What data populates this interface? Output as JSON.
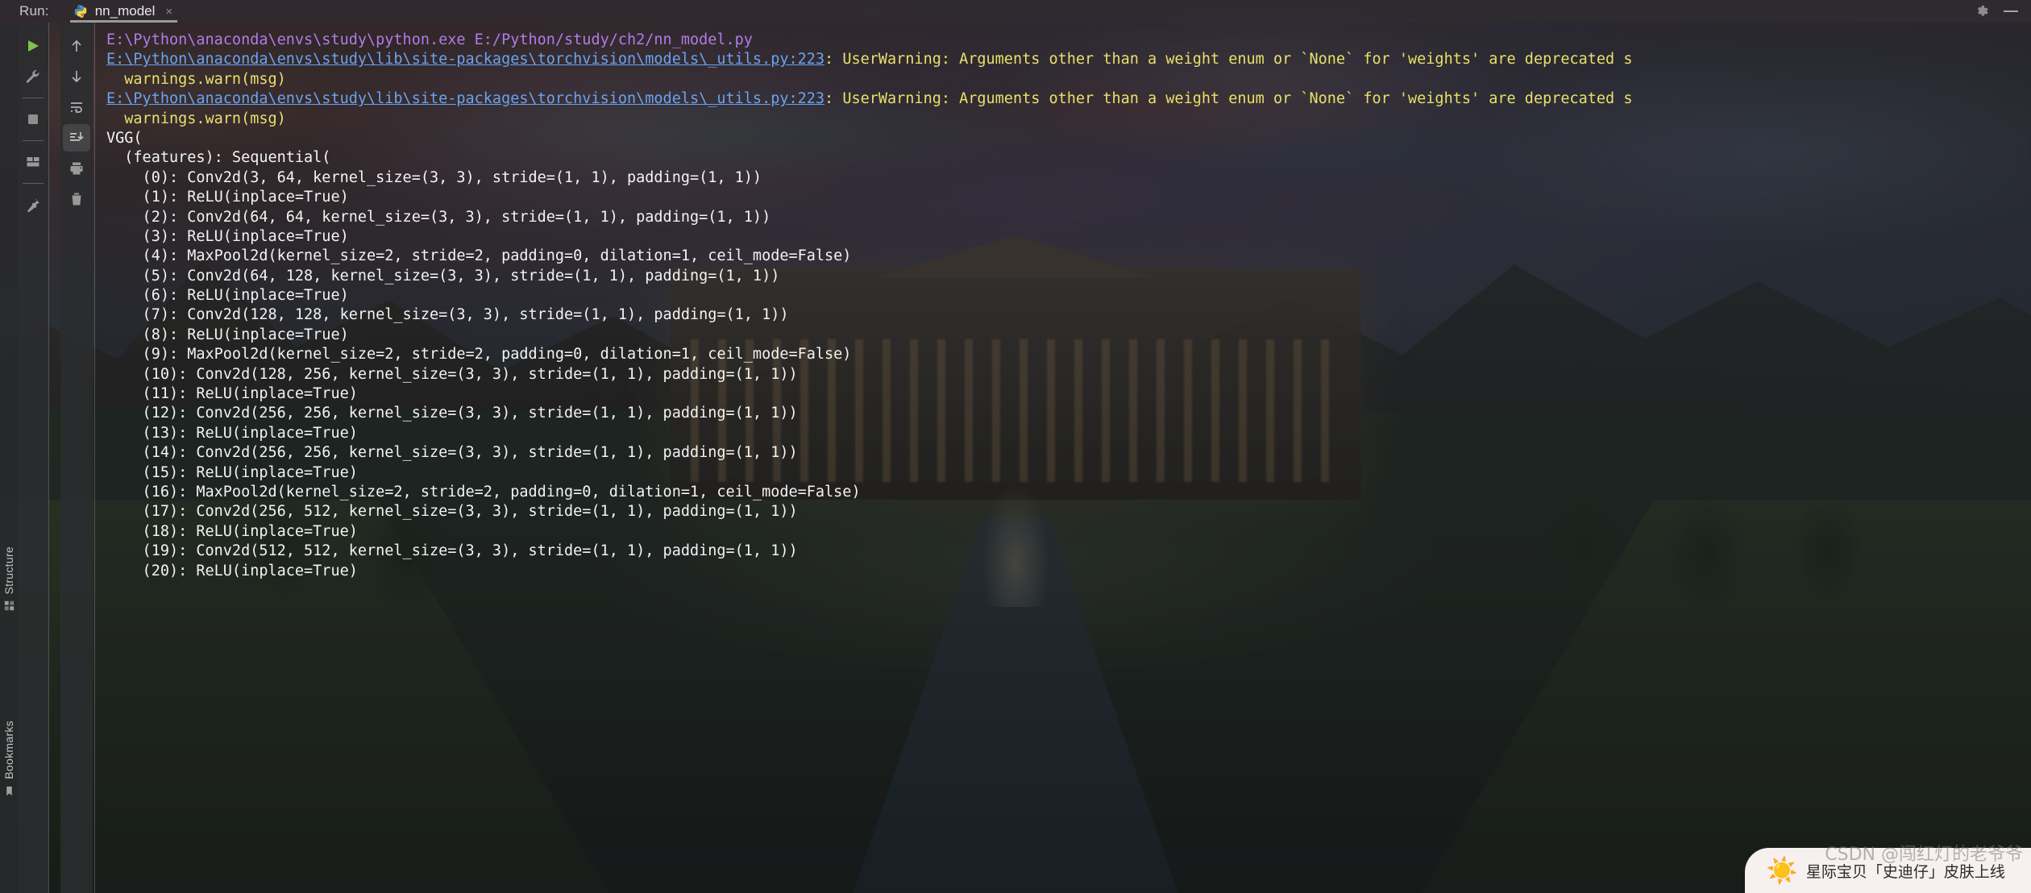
{
  "header": {
    "run_label": "Run:",
    "tab": {
      "title": "nn_model",
      "icon": "python-icon",
      "close": "×"
    },
    "settings_icon": "gear-icon",
    "minimize_icon": "minimize-icon"
  },
  "toolbar_primary": [
    {
      "name": "rerun-button",
      "icon": "play-icon"
    },
    {
      "name": "edit-configurations-button",
      "icon": "wrench-icon"
    },
    {
      "name": "stop-button",
      "icon": "stop-square-icon"
    },
    {
      "name": "layout-button",
      "icon": "layout-grid-icon"
    },
    {
      "name": "pin-tab-button",
      "icon": "pin-icon"
    }
  ],
  "toolbar_secondary": [
    {
      "name": "up-the-stack-trace-button",
      "icon": "arrow-up-icon"
    },
    {
      "name": "down-the-stack-trace-button",
      "icon": "arrow-down-icon"
    },
    {
      "name": "soft-wrap-button",
      "icon": "soft-wrap-icon"
    },
    {
      "name": "scroll-to-end-button",
      "icon": "scroll-to-end-icon",
      "active": true
    },
    {
      "name": "print-button",
      "icon": "printer-icon"
    },
    {
      "name": "clear-all-button",
      "icon": "trash-icon"
    }
  ],
  "side_tool_windows": [
    {
      "name": "structure",
      "label": "Structure",
      "icon": "structure-icon"
    },
    {
      "name": "bookmarks",
      "label": "Bookmarks",
      "icon": "bookmark-icon"
    }
  ],
  "console": {
    "lines": [
      {
        "style": "purple",
        "text": "E:\\Python\\anaconda\\envs\\study\\python.exe E:/Python/study/ch2/nn_model.py"
      },
      {
        "style": "link-warn",
        "link": "E:\\Python\\anaconda\\envs\\study\\lib\\site-packages\\torchvision\\models\\_utils.py:223",
        "warn": ": UserWarning: Arguments other than a weight enum or `None` for 'weights' are deprecated s"
      },
      {
        "style": "warn",
        "text": "  warnings.warn(msg)"
      },
      {
        "style": "link-warn",
        "link": "E:\\Python\\anaconda\\envs\\study\\lib\\site-packages\\torchvision\\models\\_utils.py:223",
        "warn": ": UserWarning: Arguments other than a weight enum or `None` for 'weights' are deprecated s"
      },
      {
        "style": "warn",
        "text": "  warnings.warn(msg)"
      },
      {
        "style": "white",
        "text": "VGG("
      },
      {
        "style": "white",
        "text": "  (features): Sequential("
      },
      {
        "style": "white",
        "text": "    (0): Conv2d(3, 64, kernel_size=(3, 3), stride=(1, 1), padding=(1, 1))"
      },
      {
        "style": "white",
        "text": "    (1): ReLU(inplace=True)"
      },
      {
        "style": "white",
        "text": "    (2): Conv2d(64, 64, kernel_size=(3, 3), stride=(1, 1), padding=(1, 1))"
      },
      {
        "style": "white",
        "text": "    (3): ReLU(inplace=True)"
      },
      {
        "style": "white",
        "text": "    (4): MaxPool2d(kernel_size=2, stride=2, padding=0, dilation=1, ceil_mode=False)"
      },
      {
        "style": "white",
        "text": "    (5): Conv2d(64, 128, kernel_size=(3, 3), stride=(1, 1), padding=(1, 1))"
      },
      {
        "style": "white",
        "text": "    (6): ReLU(inplace=True)"
      },
      {
        "style": "white",
        "text": "    (7): Conv2d(128, 128, kernel_size=(3, 3), stride=(1, 1), padding=(1, 1))"
      },
      {
        "style": "white",
        "text": "    (8): ReLU(inplace=True)"
      },
      {
        "style": "white",
        "text": "    (9): MaxPool2d(kernel_size=2, stride=2, padding=0, dilation=1, ceil_mode=False)"
      },
      {
        "style": "white",
        "text": "    (10): Conv2d(128, 256, kernel_size=(3, 3), stride=(1, 1), padding=(1, 1))"
      },
      {
        "style": "white",
        "text": "    (11): ReLU(inplace=True)"
      },
      {
        "style": "white",
        "text": "    (12): Conv2d(256, 256, kernel_size=(3, 3), stride=(1, 1), padding=(1, 1))"
      },
      {
        "style": "white",
        "text": "    (13): ReLU(inplace=True)"
      },
      {
        "style": "white",
        "text": "    (14): Conv2d(256, 256, kernel_size=(3, 3), stride=(1, 1), padding=(1, 1))"
      },
      {
        "style": "white",
        "text": "    (15): ReLU(inplace=True)"
      },
      {
        "style": "white",
        "text": "    (16): MaxPool2d(kernel_size=2, stride=2, padding=0, dilation=1, ceil_mode=False)"
      },
      {
        "style": "white",
        "text": "    (17): Conv2d(256, 512, kernel_size=(3, 3), stride=(1, 1), padding=(1, 1))"
      },
      {
        "style": "white",
        "text": "    (18): ReLU(inplace=True)"
      },
      {
        "style": "white",
        "text": "    (19): Conv2d(512, 512, kernel_size=(3, 3), stride=(1, 1), padding=(1, 1))"
      },
      {
        "style": "white",
        "text": "    (20): ReLU(inplace=True)"
      }
    ]
  },
  "popup": {
    "emoji": "☀️",
    "text": "星际宝贝「史迪仔」皮肤上线"
  },
  "watermark": {
    "text": "CSDN @闯红灯的老爷爷"
  },
  "colors": {
    "console_white": "#f3f3f3",
    "console_purple": "#b07ce8",
    "console_link": "#6aa3f0",
    "console_warning": "#e8e06a",
    "toolbar_bg": "#2b2c2f",
    "run_icon_green": "#7fc34a"
  }
}
